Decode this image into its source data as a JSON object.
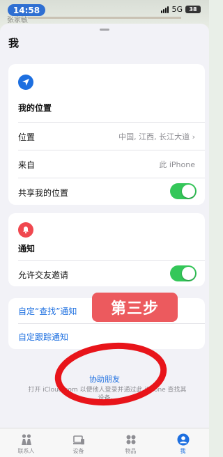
{
  "status_bar": {
    "time": "14:58",
    "network": "5G",
    "battery": "38"
  },
  "map": {
    "place_name": "张家敏"
  },
  "sheet": {
    "title": "我"
  },
  "location_card": {
    "heading": "我的位置",
    "rows": {
      "location": {
        "label": "位置",
        "value": "中国, 江西, 长江大道 ›"
      },
      "from": {
        "label": "来自",
        "value": "此 iPhone"
      },
      "share": {
        "label": "共享我的位置"
      }
    }
  },
  "notification_card": {
    "heading": "通知",
    "rows": {
      "allow_invites": {
        "label": "允许交友邀请"
      }
    }
  },
  "link_card": {
    "custom_find": "自定“查找”通知",
    "custom_tracking": "自定跟踪通知"
  },
  "annotation": {
    "step_label": "第三步"
  },
  "help": {
    "link": "协助朋友",
    "note": "打开 iCloud.com 以便他人登录并通过此 iPhone 查找其设备。"
  },
  "tabs": [
    {
      "label": "联系人",
      "icon": "people-icon",
      "active": false
    },
    {
      "label": "设备",
      "icon": "devices-icon",
      "active": false
    },
    {
      "label": "物品",
      "icon": "items-icon",
      "active": false
    },
    {
      "label": "我",
      "icon": "me-icon",
      "active": true
    }
  ],
  "colors": {
    "accent": "#1d6fe0",
    "toggle_on": "#34c759",
    "annotation_red": "#ec5a5e",
    "ellipse_red": "#e8141a",
    "notify_icon": "#f0484f"
  }
}
